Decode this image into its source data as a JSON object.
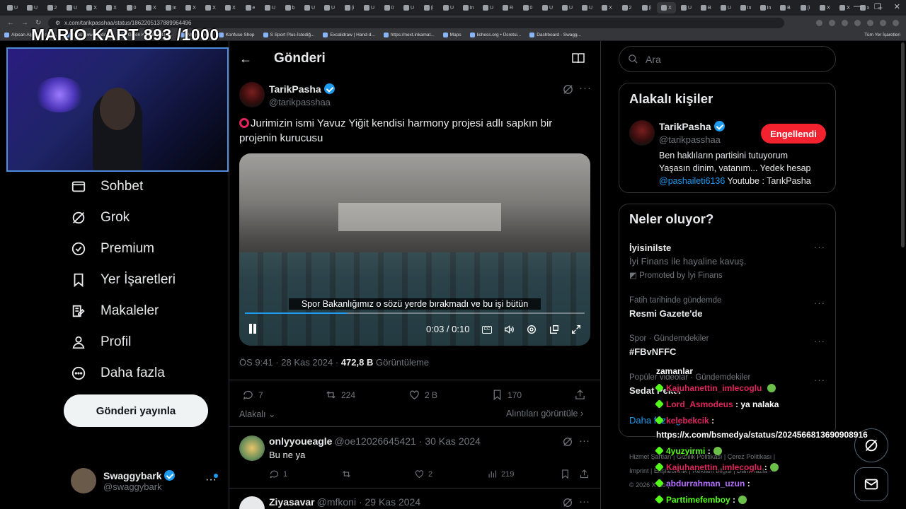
{
  "browser": {
    "tabs": [
      "U",
      "U",
      "2",
      "U",
      "X",
      "X",
      "0",
      "X",
      "In",
      "X",
      "X",
      "X",
      "e",
      "U",
      "b",
      "U",
      "U",
      "(i",
      "U",
      "0",
      "U",
      "(i",
      "U",
      "In",
      "U",
      "R",
      "0",
      "U",
      "U",
      "U",
      "X",
      "2",
      "(i",
      "X",
      "U",
      "B",
      "U",
      "In",
      "In",
      "B",
      "(i",
      "X",
      "X",
      "x"
    ],
    "url": "x.com/tarikpasshaa/status/1862205137889964496",
    "bookmarks": [
      "Alpcan Alpar (@swa...",
      "https://www.reddit...",
      "Gelen Kutusu (31) -...",
      "Midjourney",
      "Konfuse Shop",
      "S Sport Plus-İstediğ...",
      "Excalidraw | Hand-d...",
      "https://next.inkamat...",
      "Maps",
      "lichess.org • Ücretsi...",
      "Dashboard - Swagg..."
    ],
    "all_bookmarks": "Tüm Yer İşaretleri"
  },
  "overlay": {
    "title": "MARIO KART   893 /1000"
  },
  "nav": {
    "items": [
      {
        "label": "Sohbet",
        "icon": "mail-icon"
      },
      {
        "label": "Grok",
        "icon": "grok-icon"
      },
      {
        "label": "Premium",
        "icon": "premium-icon"
      },
      {
        "label": "Yer İşaretleri",
        "icon": "bookmark-icon"
      },
      {
        "label": "Makaleler",
        "icon": "article-icon"
      },
      {
        "label": "Profil",
        "icon": "profile-icon"
      },
      {
        "label": "Daha fazla",
        "icon": "more-circle-icon"
      }
    ],
    "post_button": "Gönderi yayınla",
    "account": {
      "name": "Swaggybark",
      "handle": "@swaggybark"
    }
  },
  "post": {
    "header": "Gönderi",
    "author": "TarikPasha",
    "handle": "@tarikpasshaa",
    "text": "Jurimizin ismi Yavuz Yiğit kendisi harmony projesi adlı sapkın bir projenin kurucusu",
    "video": {
      "subtitle": "Spor Bakanlığımız o sözü yerde bırakmadı ve bu işi bütün",
      "time": "0:03 / 0:10",
      "progress": 0.3
    },
    "timestamp": "ÖS 9:41 · 28 Kas 2024 · ",
    "views": "472,8 B",
    "views_label": " Görüntüleme",
    "actions": {
      "replies": "7",
      "reposts": "224",
      "likes": "2 B",
      "bookmarks": "170"
    },
    "sort_label": "Alakalı",
    "quotes_label": "Alıntıları görüntüle"
  },
  "replies": [
    {
      "name": "onlyyoueagle",
      "meta": "@oe12026645421 · 30 Kas 2024",
      "text": "Bu ne ya",
      "replies": "1",
      "likes": "2",
      "views": "219"
    },
    {
      "name": "Ziyasavar",
      "meta": "@mfkoni · 29 Kas 2024",
      "text": ""
    }
  ],
  "search": {
    "placeholder": "Ara"
  },
  "related": {
    "title": "Alakalı kişiler",
    "name": "TarikPasha",
    "handle": "@tarikpasshaa",
    "button": "Engellendi",
    "bio_line1": "Ben haklıların partisini tutuyorum",
    "bio_line2": "Yaşasın dinim, vatanım... Yedek hesap",
    "bio_link": "@pashaileti6136",
    "bio_tail": " Youtube : TarıkPasha"
  },
  "trends": {
    "title": "Neler oluyor?",
    "items": [
      {
        "context": "",
        "name": "İyisinilste",
        "desc": "İyi Finans ile hayaline kavuş.",
        "promo": "Promoted by İyi Finans"
      },
      {
        "context": "Fatih tarihinde gündemde",
        "name": "Resmi Gazete'de"
      },
      {
        "context": "Spor · Gündemdekiler",
        "name": "#FBvNFFC"
      },
      {
        "context": "Popüler videolar · Gündemdekiler",
        "name": "Sedat Peker"
      }
    ],
    "show_more": "Daha fazla göster"
  },
  "footer": {
    "line1": "Hizmet Şartları  |  Gizlilik Politikası  |  Çerez Politikası  |",
    "line2": "Imprint  |  Erişilebilirlik  |  Reklam bilgisi  |  Daha fazla ···",
    "line3": "© 2026 X Corp."
  },
  "chat": [
    {
      "user": "zamanlar",
      "msg": "",
      "color": "#ffffff"
    },
    {
      "user": "Kajuhanettin_imlecoglu",
      "msg": "",
      "color": "#e0245e"
    },
    {
      "user": "Lord_Asmodeus",
      "msg": ": ya nalaka",
      "color": "#e0245e"
    },
    {
      "user": "kelebekcik",
      "msg": ":",
      "color": "#e0245e"
    },
    {
      "user": "",
      "msg": "https://x.com/bsmedya/status/2024566813690908916",
      "color": "#ffffff"
    },
    {
      "user": "4yuzyirmi",
      "msg": ":",
      "color": "#53fc18"
    },
    {
      "user": "Kajuhanettin_imlecoglu",
      "msg": ":",
      "color": "#e0245e"
    },
    {
      "user": "abdurrahman_uzun",
      "msg": ":",
      "color": "#b46dff"
    },
    {
      "user": "Parttimefemboy",
      "msg": ":",
      "color": "#53fc18"
    }
  ]
}
